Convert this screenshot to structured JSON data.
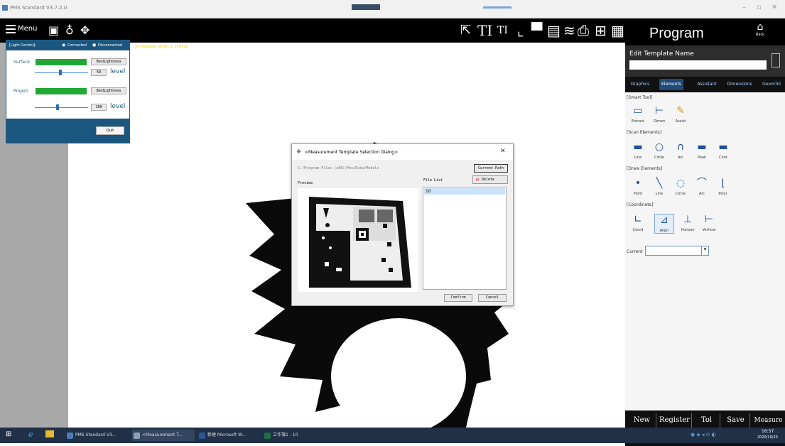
{
  "os": {
    "window_title": "PMS Standard V3.7.2.0",
    "controls": [
      "–",
      "▫",
      "✕"
    ]
  },
  "toolbar": {
    "menu_label": "Menu",
    "icons": [
      "camera-icon",
      "lightbulb-icon",
      "light-settings-icon",
      "cursor-arrow-icon",
      "text-large-icon",
      "text-small-icon",
      "crop-icon",
      "window-icon",
      "report-icon",
      "stack-icon",
      "camera-tool-icon",
      "grid-icon",
      "list-icon"
    ]
  },
  "light_control": {
    "header": "[Light Control]:",
    "connected": "Connected",
    "disconnected": "Disconnected",
    "message": "Some power ability in setting",
    "surface_label": "Surface",
    "surface_btn": "BestLightness",
    "surface_value": "50",
    "level_label": "level",
    "project_label": "Project",
    "project_btn": "BestLightness",
    "project_value": "100",
    "quit_label": "Quit",
    "surface_level_fraction": 0.45,
    "project_level_fraction": 0.4
  },
  "program": {
    "title": "Program",
    "back_label": "Back",
    "edit_template_label": "Edit Template Name",
    "edit_template_value": "",
    "tabs": [
      "Graphics",
      "Elements",
      "Assistant",
      "Dimensions",
      "GeomTol"
    ],
    "active_tab": "Elements",
    "sections": {
      "smart_tool": "[Smart Tool]",
      "scan_elements": "[Scan Elements]",
      "draw_elements": "[Draw Elements]",
      "coordinate": "[Coordinate]"
    },
    "smart_tools": [
      "Extract",
      "Dimen",
      "Assist"
    ],
    "scan_tools": [
      "Line",
      "Circle",
      "Arc",
      "Peak",
      "Cont"
    ],
    "draw_tools": [
      "Point",
      "Line",
      "Circle",
      "Arc",
      "Polyl."
    ],
    "coord_tools": [
      "Coord",
      "Align",
      "Horizon",
      "Vertical"
    ],
    "current_label": "Current",
    "current_value": "",
    "bottom_buttons": [
      "New",
      "Register",
      "Tol",
      "Save",
      "Measure"
    ]
  },
  "dialog": {
    "title": "<Measurement Template Selection Dialog>",
    "path": "C:/Program Files (x86)/Pms/Data/Models",
    "current_path_btn": "Current Path",
    "preview_label": "Preview",
    "file_list_label": "File List",
    "delete_btn": "Delete",
    "files": [
      "10"
    ],
    "confirm_btn": "Confirm",
    "cancel_btn": "Cancel"
  },
  "taskbar": {
    "tasks": [
      "PMS Standard V3...",
      "<Measurement T...",
      "新建 Microsoft W...",
      "工作簿1 - 10"
    ],
    "time": "16:57",
    "date": "2020/10/20"
  }
}
